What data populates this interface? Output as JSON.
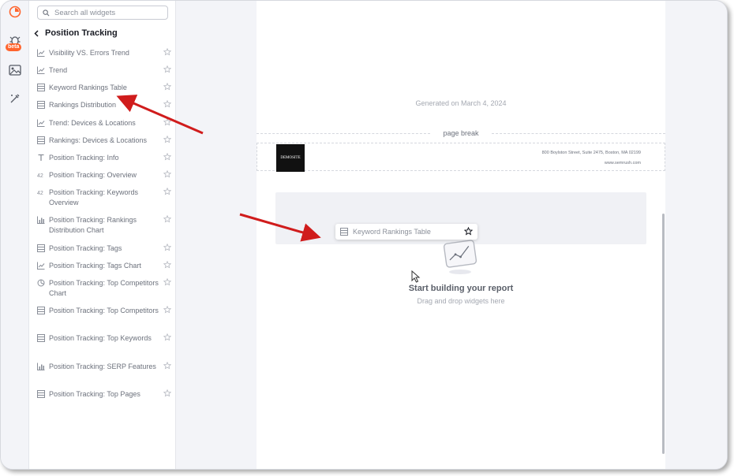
{
  "rail": {
    "beta_label": "beta"
  },
  "search": {
    "placeholder": "Search all widgets"
  },
  "section": {
    "title": "Position Tracking"
  },
  "widgets": [
    {
      "label": "Visibility VS. Errors Trend",
      "icon": "line-chart-icon"
    },
    {
      "label": "Trend",
      "icon": "line-chart-icon"
    },
    {
      "label": "Keyword Rankings Table",
      "icon": "table-icon"
    },
    {
      "label": "Rankings Distribution",
      "icon": "table-icon"
    },
    {
      "label": "Trend: Devices & Locations",
      "icon": "line-chart-icon"
    },
    {
      "label": "Rankings: Devices & Locations",
      "icon": "table-icon"
    },
    {
      "label": "Position Tracking: Info",
      "icon": "text-icon"
    },
    {
      "label": "Position Tracking: Overview",
      "icon": "number-icon"
    },
    {
      "label": "Position Tracking: Keywords Overview",
      "icon": "number-icon"
    },
    {
      "label": "Position Tracking: Rankings Distribution Chart",
      "icon": "bar-chart-icon"
    },
    {
      "label": "Position Tracking: Tags",
      "icon": "table-icon"
    },
    {
      "label": "Position Tracking: Tags Chart",
      "icon": "line-chart-icon"
    },
    {
      "label": "Position Tracking: Top Competitors Chart",
      "icon": "pie-chart-icon"
    },
    {
      "label": "Position Tracking: Top Competitors",
      "icon": "table-icon"
    },
    {
      "label": "Position Tracking: Top Keywords",
      "icon": "table-icon"
    },
    {
      "label": "Position Tracking: SERP Features",
      "icon": "bar-chart-icon"
    },
    {
      "label": "Position Tracking: Top Pages",
      "icon": "table-icon"
    }
  ],
  "report": {
    "generated": "Generated on March 4, 2024",
    "page_break": "page break",
    "logo_text": "DEMOSITE",
    "address": "800 Boylston Street, Suite 2475, Boston, MA 02199",
    "website": "www.semrush.com",
    "drag_card_label": "Keyword Rankings Table",
    "start_title": "Start building your report",
    "start_sub": "Drag and drop widgets here"
  },
  "colors": {
    "accent": "#ff642d",
    "annotation_arrow": "#d01c1c"
  }
}
